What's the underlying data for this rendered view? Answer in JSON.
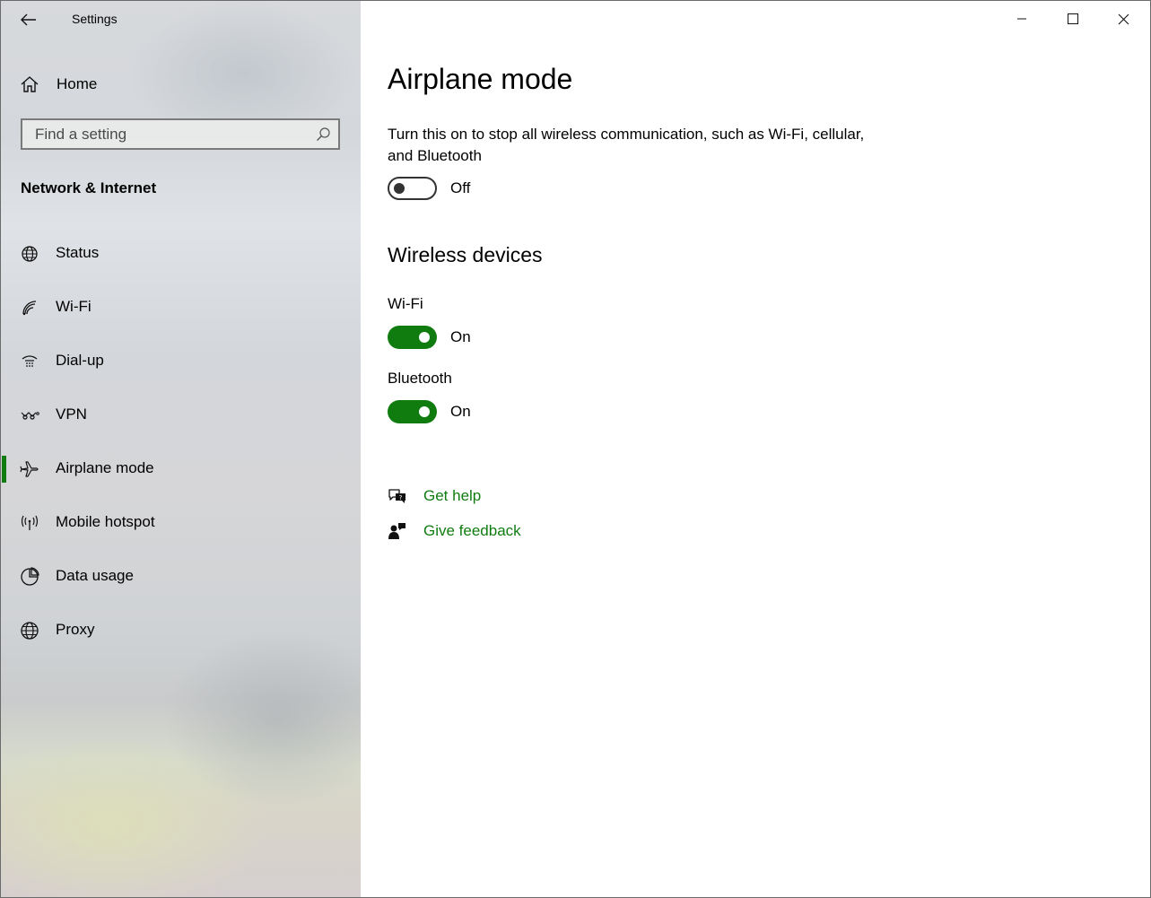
{
  "window": {
    "title": "Settings",
    "controls": {
      "minimize": "minimize-icon",
      "maximize": "maximize-icon",
      "close": "close-icon"
    }
  },
  "sidebar": {
    "home_label": "Home",
    "search": {
      "placeholder": "Find a setting",
      "value": ""
    },
    "section_title": "Network & Internet",
    "items": [
      {
        "label": "Status",
        "icon": "globe-status-icon",
        "selected": false
      },
      {
        "label": "Wi-Fi",
        "icon": "wifi-icon",
        "selected": false
      },
      {
        "label": "Dial-up",
        "icon": "dialup-icon",
        "selected": false
      },
      {
        "label": "VPN",
        "icon": "vpn-icon",
        "selected": false
      },
      {
        "label": "Airplane mode",
        "icon": "airplane-icon",
        "selected": true
      },
      {
        "label": "Mobile hotspot",
        "icon": "hotspot-icon",
        "selected": false
      },
      {
        "label": "Data usage",
        "icon": "data-usage-icon",
        "selected": false
      },
      {
        "label": "Proxy",
        "icon": "globe-icon",
        "selected": false
      }
    ]
  },
  "main": {
    "title": "Airplane mode",
    "description": "Turn this on to stop all wireless communication, such as Wi-Fi, cellular, and Bluetooth",
    "airplane_toggle": {
      "state": "Off",
      "on": false
    },
    "wireless_heading": "Wireless devices",
    "wifi": {
      "label": "Wi-Fi",
      "state": "On",
      "on": true
    },
    "bluetooth": {
      "label": "Bluetooth",
      "state": "On",
      "on": true
    },
    "links": {
      "help": "Get help",
      "feedback": "Give feedback"
    }
  },
  "colors": {
    "accent": "#107c10",
    "toggle_off_border": "#333333"
  }
}
